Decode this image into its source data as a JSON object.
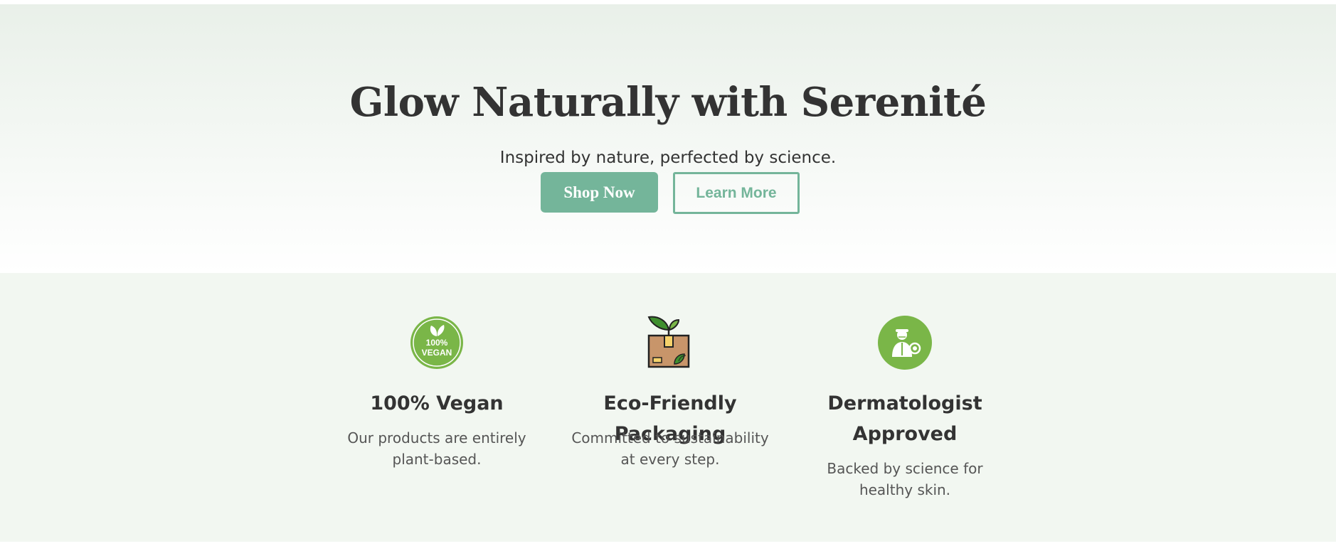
{
  "hero": {
    "title": "Glow Naturally with Serenité",
    "subtitle": "Inspired by nature, perfected by science.",
    "primary_button": "Shop Now",
    "secondary_button": "Learn More"
  },
  "features": [
    {
      "icon": "vegan-badge-icon",
      "icon_text_top": "100%",
      "icon_text_bottom": "VEGAN",
      "title": "100% Vegan",
      "text": "Our products are entirely plant-based."
    },
    {
      "icon": "eco-box-icon",
      "title": "Eco-Friendly Packaging",
      "text": "Committed to sustainability at every step."
    },
    {
      "icon": "dermatologist-icon",
      "title": "Dermatologist Approved",
      "text": "Backed by science for healthy skin."
    }
  ],
  "colors": {
    "accent": "#74b59a",
    "icon_green": "#7ab648",
    "text_dark": "#333333",
    "text_muted": "#555555",
    "features_bg": "#f2f7f1"
  }
}
